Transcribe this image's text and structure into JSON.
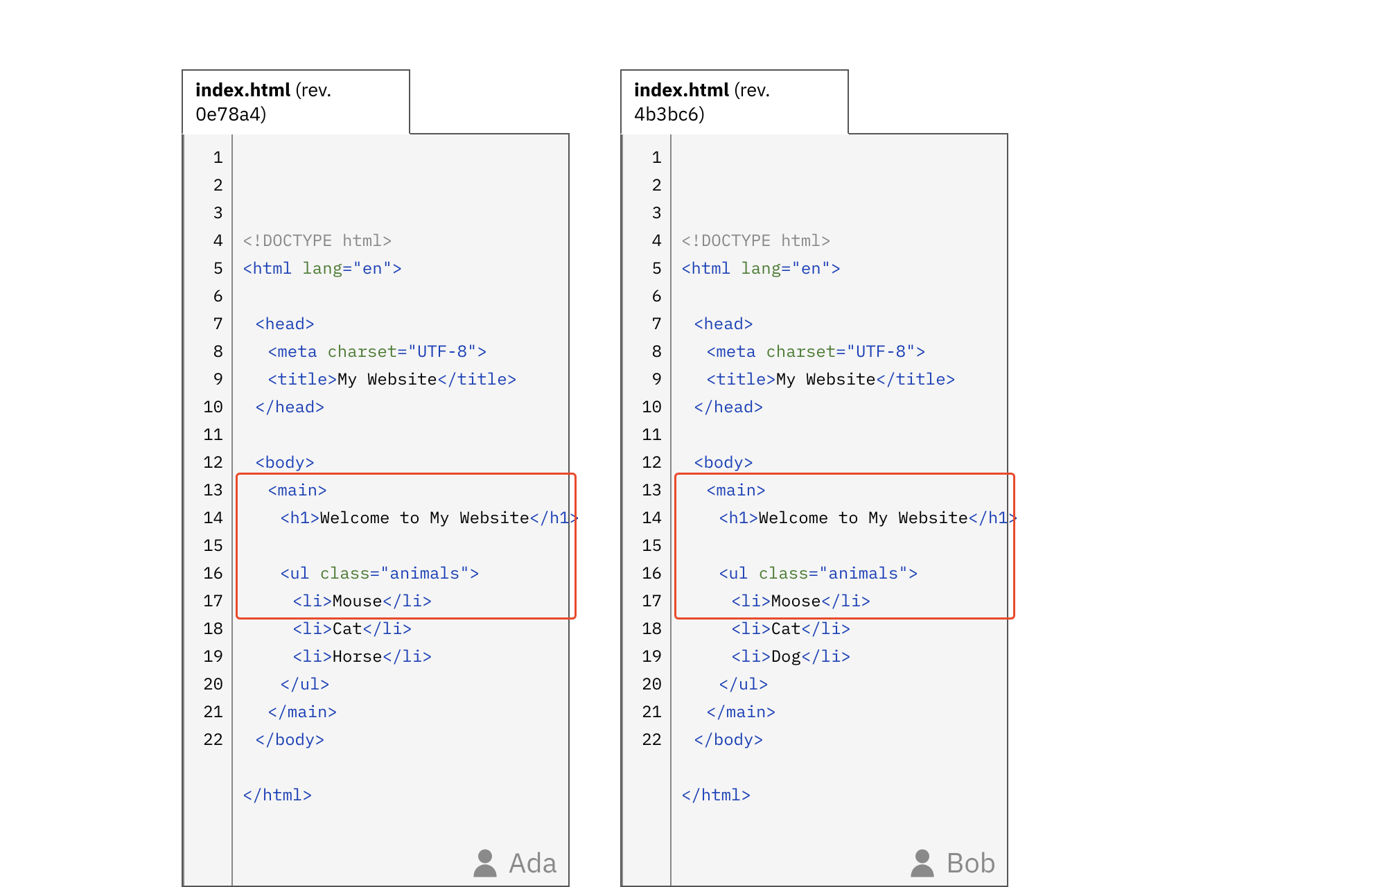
{
  "center": {
    "question_mark": "?"
  },
  "panels": {
    "left": {
      "filename": "index.html",
      "revision_label": "(rev. 0e78a4)",
      "revision": "0e78a4",
      "author": "Ada",
      "diff_lines": {
        "start": 13,
        "end": 17
      },
      "total_lines": 22,
      "code": [
        {
          "n": 1,
          "indent": 0,
          "segments": [
            {
              "cls": "c-muted",
              "t": "<!DOCTYPE html>"
            }
          ]
        },
        {
          "n": 2,
          "indent": 0,
          "segments": [
            {
              "cls": "c-tag",
              "t": "<html "
            },
            {
              "cls": "c-attr",
              "t": "lang"
            },
            {
              "cls": "c-tag",
              "t": "="
            },
            {
              "cls": "c-str",
              "t": "\"en\""
            },
            {
              "cls": "c-tag",
              "t": ">"
            }
          ]
        },
        {
          "n": 3,
          "indent": 0,
          "segments": []
        },
        {
          "n": 4,
          "indent": 1,
          "segments": [
            {
              "cls": "c-tag",
              "t": "<head>"
            }
          ]
        },
        {
          "n": 5,
          "indent": 2,
          "segments": [
            {
              "cls": "c-tag",
              "t": "<meta "
            },
            {
              "cls": "c-attr",
              "t": "charset"
            },
            {
              "cls": "c-tag",
              "t": "="
            },
            {
              "cls": "c-str",
              "t": "\"UTF-8\""
            },
            {
              "cls": "c-tag",
              "t": ">"
            }
          ]
        },
        {
          "n": 6,
          "indent": 2,
          "segments": [
            {
              "cls": "c-tag",
              "t": "<title>"
            },
            {
              "cls": "c-text",
              "t": "My Website"
            },
            {
              "cls": "c-tag",
              "t": "</title>"
            }
          ]
        },
        {
          "n": 7,
          "indent": 1,
          "segments": [
            {
              "cls": "c-tag",
              "t": "</head>"
            }
          ]
        },
        {
          "n": 8,
          "indent": 0,
          "segments": []
        },
        {
          "n": 9,
          "indent": 1,
          "segments": [
            {
              "cls": "c-tag",
              "t": "<body>"
            }
          ]
        },
        {
          "n": 10,
          "indent": 2,
          "segments": [
            {
              "cls": "c-tag",
              "t": "<main>"
            }
          ]
        },
        {
          "n": 11,
          "indent": 3,
          "segments": [
            {
              "cls": "c-tag",
              "t": "<h1>"
            },
            {
              "cls": "c-text",
              "t": "Welcome to My Website"
            },
            {
              "cls": "c-tag",
              "t": "</h1>"
            }
          ]
        },
        {
          "n": 12,
          "indent": 0,
          "segments": []
        },
        {
          "n": 13,
          "indent": 3,
          "segments": [
            {
              "cls": "c-tag",
              "t": "<ul "
            },
            {
              "cls": "c-attr",
              "t": "class"
            },
            {
              "cls": "c-tag",
              "t": "="
            },
            {
              "cls": "c-str",
              "t": "\"animals\""
            },
            {
              "cls": "c-tag",
              "t": ">"
            }
          ]
        },
        {
          "n": 14,
          "indent": 4,
          "segments": [
            {
              "cls": "c-tag",
              "t": "<li>"
            },
            {
              "cls": "c-text",
              "t": "Mouse"
            },
            {
              "cls": "c-tag",
              "t": "</li>"
            }
          ]
        },
        {
          "n": 15,
          "indent": 4,
          "segments": [
            {
              "cls": "c-tag",
              "t": "<li>"
            },
            {
              "cls": "c-text",
              "t": "Cat"
            },
            {
              "cls": "c-tag",
              "t": "</li>"
            }
          ]
        },
        {
          "n": 16,
          "indent": 4,
          "segments": [
            {
              "cls": "c-tag",
              "t": "<li>"
            },
            {
              "cls": "c-text",
              "t": "Horse"
            },
            {
              "cls": "c-tag",
              "t": "</li>"
            }
          ]
        },
        {
          "n": 17,
          "indent": 3,
          "segments": [
            {
              "cls": "c-tag",
              "t": "</ul>"
            }
          ]
        },
        {
          "n": 18,
          "indent": 2,
          "segments": [
            {
              "cls": "c-tag",
              "t": "</main>"
            }
          ]
        },
        {
          "n": 19,
          "indent": 1,
          "segments": [
            {
              "cls": "c-tag",
              "t": "</body>"
            }
          ]
        },
        {
          "n": 20,
          "indent": 0,
          "segments": []
        },
        {
          "n": 21,
          "indent": 0,
          "segments": [
            {
              "cls": "c-tag",
              "t": "</html>"
            }
          ]
        },
        {
          "n": 22,
          "indent": 0,
          "segments": []
        }
      ]
    },
    "right": {
      "filename": "index.html",
      "revision_label": "(rev. 4b3bc6)",
      "revision": "4b3bc6",
      "author": "Bob",
      "diff_lines": {
        "start": 13,
        "end": 17
      },
      "total_lines": 22,
      "code": [
        {
          "n": 1,
          "indent": 0,
          "segments": [
            {
              "cls": "c-muted",
              "t": "<!DOCTYPE html>"
            }
          ]
        },
        {
          "n": 2,
          "indent": 0,
          "segments": [
            {
              "cls": "c-tag",
              "t": "<html "
            },
            {
              "cls": "c-attr",
              "t": "lang"
            },
            {
              "cls": "c-tag",
              "t": "="
            },
            {
              "cls": "c-str",
              "t": "\"en\""
            },
            {
              "cls": "c-tag",
              "t": ">"
            }
          ]
        },
        {
          "n": 3,
          "indent": 0,
          "segments": []
        },
        {
          "n": 4,
          "indent": 1,
          "segments": [
            {
              "cls": "c-tag",
              "t": "<head>"
            }
          ]
        },
        {
          "n": 5,
          "indent": 2,
          "segments": [
            {
              "cls": "c-tag",
              "t": "<meta "
            },
            {
              "cls": "c-attr",
              "t": "charset"
            },
            {
              "cls": "c-tag",
              "t": "="
            },
            {
              "cls": "c-str",
              "t": "\"UTF-8\""
            },
            {
              "cls": "c-tag",
              "t": ">"
            }
          ]
        },
        {
          "n": 6,
          "indent": 2,
          "segments": [
            {
              "cls": "c-tag",
              "t": "<title>"
            },
            {
              "cls": "c-text",
              "t": "My Website"
            },
            {
              "cls": "c-tag",
              "t": "</title>"
            }
          ]
        },
        {
          "n": 7,
          "indent": 1,
          "segments": [
            {
              "cls": "c-tag",
              "t": "</head>"
            }
          ]
        },
        {
          "n": 8,
          "indent": 0,
          "segments": []
        },
        {
          "n": 9,
          "indent": 1,
          "segments": [
            {
              "cls": "c-tag",
              "t": "<body>"
            }
          ]
        },
        {
          "n": 10,
          "indent": 2,
          "segments": [
            {
              "cls": "c-tag",
              "t": "<main>"
            }
          ]
        },
        {
          "n": 11,
          "indent": 3,
          "segments": [
            {
              "cls": "c-tag",
              "t": "<h1>"
            },
            {
              "cls": "c-text",
              "t": "Welcome to My Website"
            },
            {
              "cls": "c-tag",
              "t": "</h1>"
            }
          ]
        },
        {
          "n": 12,
          "indent": 0,
          "segments": []
        },
        {
          "n": 13,
          "indent": 3,
          "segments": [
            {
              "cls": "c-tag",
              "t": "<ul "
            },
            {
              "cls": "c-attr",
              "t": "class"
            },
            {
              "cls": "c-tag",
              "t": "="
            },
            {
              "cls": "c-str",
              "t": "\"animals\""
            },
            {
              "cls": "c-tag",
              "t": ">"
            }
          ]
        },
        {
          "n": 14,
          "indent": 4,
          "segments": [
            {
              "cls": "c-tag",
              "t": "<li>"
            },
            {
              "cls": "c-text",
              "t": "Moose"
            },
            {
              "cls": "c-tag",
              "t": "</li>"
            }
          ]
        },
        {
          "n": 15,
          "indent": 4,
          "segments": [
            {
              "cls": "c-tag",
              "t": "<li>"
            },
            {
              "cls": "c-text",
              "t": "Cat"
            },
            {
              "cls": "c-tag",
              "t": "</li>"
            }
          ]
        },
        {
          "n": 16,
          "indent": 4,
          "segments": [
            {
              "cls": "c-tag",
              "t": "<li>"
            },
            {
              "cls": "c-text",
              "t": "Dog"
            },
            {
              "cls": "c-tag",
              "t": "</li>"
            }
          ]
        },
        {
          "n": 17,
          "indent": 3,
          "segments": [
            {
              "cls": "c-tag",
              "t": "</ul>"
            }
          ]
        },
        {
          "n": 18,
          "indent": 2,
          "segments": [
            {
              "cls": "c-tag",
              "t": "</main>"
            }
          ]
        },
        {
          "n": 19,
          "indent": 1,
          "segments": [
            {
              "cls": "c-tag",
              "t": "</body>"
            }
          ]
        },
        {
          "n": 20,
          "indent": 0,
          "segments": []
        },
        {
          "n": 21,
          "indent": 0,
          "segments": [
            {
              "cls": "c-tag",
              "t": "</html>"
            }
          ]
        },
        {
          "n": 22,
          "indent": 0,
          "segments": []
        }
      ]
    }
  }
}
